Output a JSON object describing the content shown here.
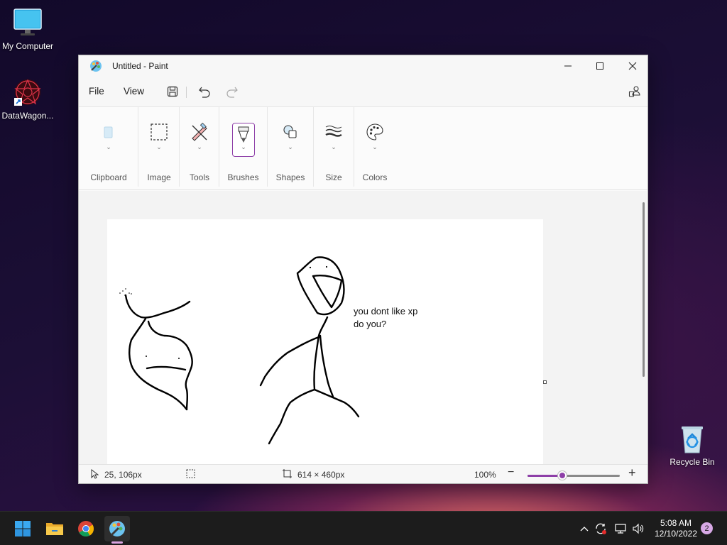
{
  "desktop": {
    "icons": [
      {
        "label": "My Computer",
        "icon": "monitor-icon"
      },
      {
        "label": "DataWagon...",
        "icon": "datawagon-icon"
      },
      {
        "label": "Recycle Bin",
        "icon": "recycle-bin-icon"
      }
    ]
  },
  "window": {
    "title": "Untitled - Paint",
    "app_icon": "paint-icon"
  },
  "menu": {
    "file": "File",
    "view": "View"
  },
  "ribbon": {
    "groups": [
      {
        "label": "Clipboard",
        "icon": "clipboard-icon"
      },
      {
        "label": "Image",
        "icon": "selection-icon"
      },
      {
        "label": "Tools",
        "icon": "tools-icon"
      },
      {
        "label": "Brushes",
        "icon": "brush-icon"
      },
      {
        "label": "Shapes",
        "icon": "shapes-icon"
      },
      {
        "label": "Size",
        "icon": "size-icon"
      },
      {
        "label": "Colors",
        "icon": "palette-icon"
      }
    ],
    "active_group": "Brushes"
  },
  "canvas": {
    "text": [
      "you dont like xp",
      "do you?"
    ]
  },
  "status": {
    "cursor_position": "25, 106px",
    "canvas_size": "614 × 460px",
    "zoom": "100%",
    "zoom_slider_fraction": 0.38
  },
  "colors": {
    "accent": "#8e3fa8",
    "taskbar": "#1c1c1c"
  },
  "taskbar": {
    "apps": [
      "start-icon",
      "file-explorer-icon",
      "chrome-icon",
      "paint-icon"
    ],
    "clock_time": "5:08 AM",
    "clock_date": "12/10/2022",
    "notification_count": "2"
  }
}
